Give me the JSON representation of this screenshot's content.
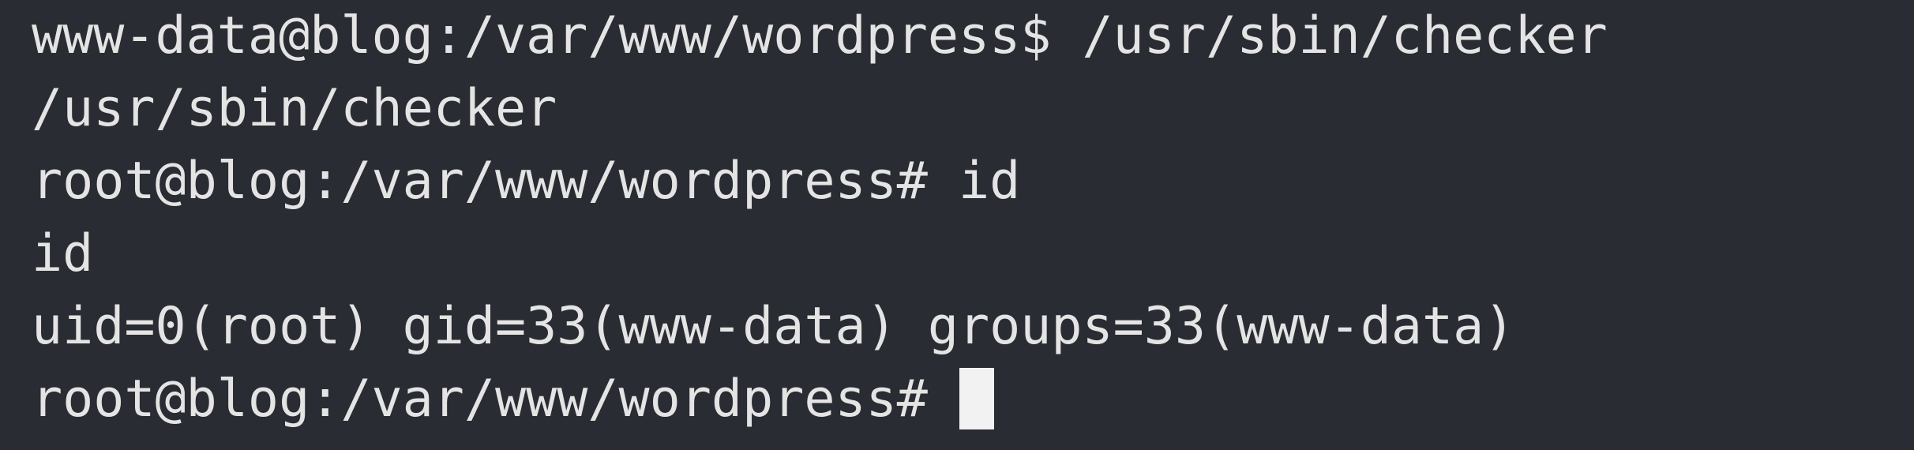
{
  "terminal": {
    "lines": [
      "www-data@blog:/var/www/wordpress$ /usr/sbin/checker",
      "/usr/sbin/checker",
      "root@blog:/var/www/wordpress# id",
      "id",
      "uid=0(root) gid=33(www-data) groups=33(www-data)"
    ],
    "prompt": "root@blog:/var/www/wordpress#"
  },
  "colors": {
    "background": "#2a2c33",
    "text": "#e4e4e4",
    "cursor": "#f2f2f2"
  }
}
